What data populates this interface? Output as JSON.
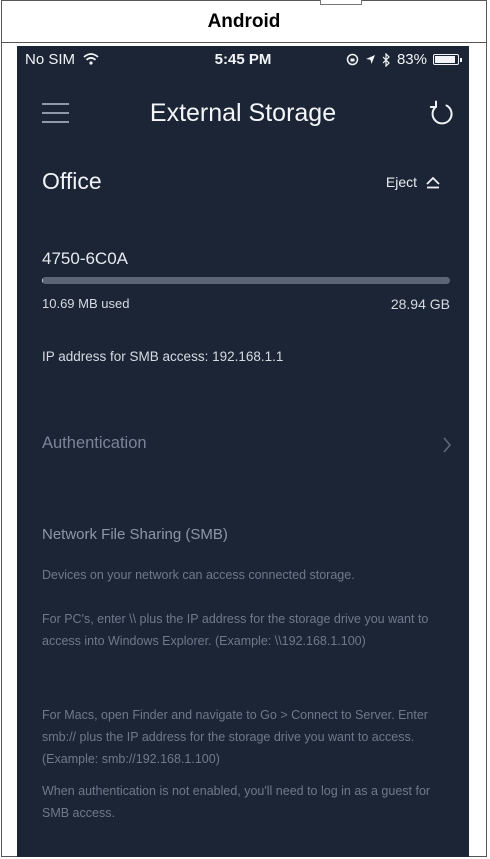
{
  "platform_label": "Android",
  "status_bar": {
    "carrier": "No SIM",
    "time": "5:45 PM",
    "battery": "83%",
    "battery_level": 0.83
  },
  "header": {
    "title": "External Storage",
    "menu_icon": "menu-icon",
    "refresh_icon": "refresh-icon"
  },
  "device": {
    "name": "Office",
    "eject_label": "Eject"
  },
  "drive": {
    "name": "4750-6C0A",
    "used_label": "10.69 MB used",
    "total_label": "28.94 GB",
    "usage_fraction": 0.0004
  },
  "ip_text": "IP address for SMB access: 192.168.1.1",
  "authentication_label": "Authentication",
  "smb": {
    "title": "Network File Sharing (SMB)",
    "paragraphs": [
      "Devices on your network can access connected storage.",
      "For PC's, enter \\\\ plus the IP address for the storage drive you want to access into Windows Explorer. (Example: \\\\192.168.1.100)",
      "For Macs, open Finder and navigate to Go > Connect to Server. Enter smb:// plus the IP address for the storage drive you want to access. (Example: smb://192.168.1.100)",
      "When authentication is not enabled, you'll need to log in as a guest for SMB access."
    ]
  },
  "colors": {
    "background": "#1b2535",
    "accent_text": "#f4f6f9",
    "muted_text": "#6f798a"
  }
}
